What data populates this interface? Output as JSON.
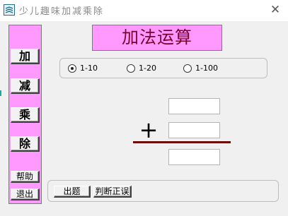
{
  "window": {
    "title": "少儿趣味加减乘除",
    "icon": "app-icon",
    "close_icon": "close-icon"
  },
  "sidebar": {
    "items": [
      {
        "label": "加"
      },
      {
        "label": "减"
      },
      {
        "label": "乘"
      },
      {
        "label": "除"
      }
    ],
    "help_label": "帮助",
    "exit_label": "退出"
  },
  "heading": "加法运算",
  "range": {
    "options": [
      {
        "label": "1-10",
        "selected": true
      },
      {
        "label": "1-20",
        "selected": false
      },
      {
        "label": "1-100",
        "selected": false
      }
    ]
  },
  "problem": {
    "operand1": "",
    "operator": "+",
    "operand2": "",
    "answer": ""
  },
  "actions": {
    "new_question_label": "出题",
    "check_label": "判断正误"
  },
  "colors": {
    "panel_pink": "#ff99ff",
    "heading_text": "#7a0030",
    "result_line": "#6b0a0a"
  }
}
